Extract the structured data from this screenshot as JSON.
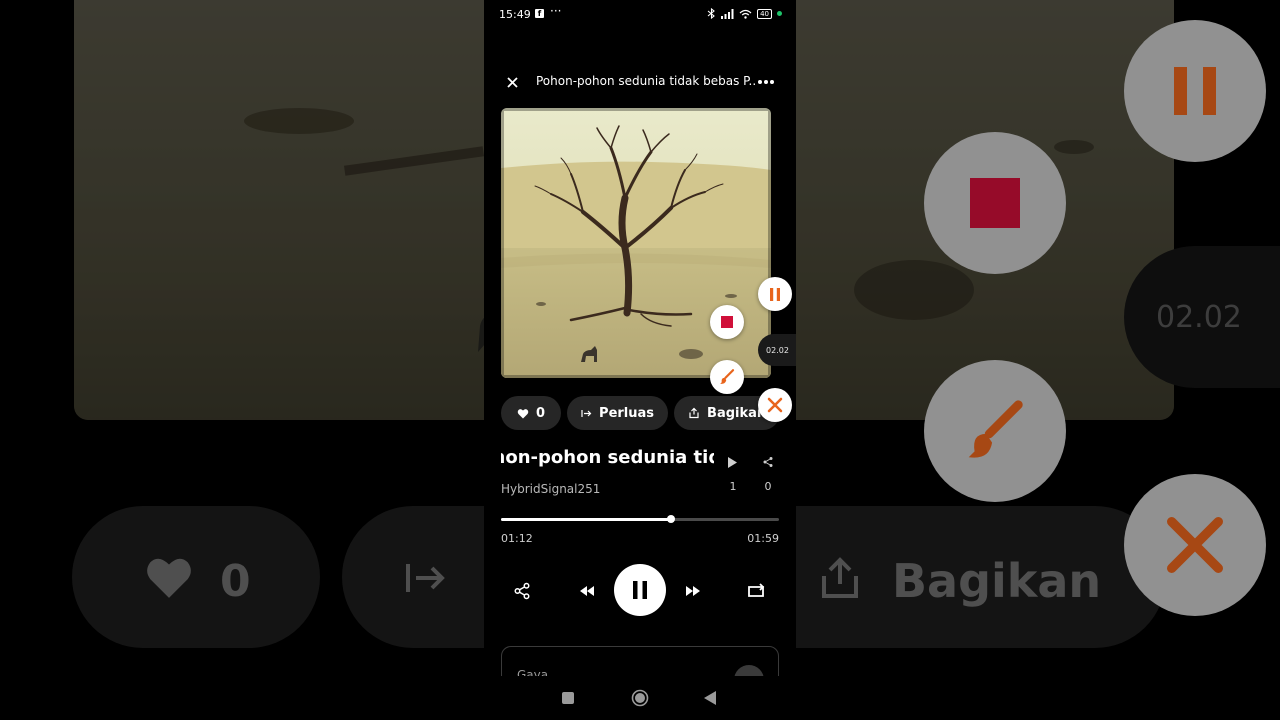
{
  "status_bar": {
    "time": "15:49",
    "notification_app": "f",
    "overflow": "···",
    "battery": "40"
  },
  "header": {
    "title": "Pohon-pohon sedunia tidak bebas P..."
  },
  "album_art": {
    "description_icon": "dead-tree-desert-artwork"
  },
  "floating_controls": {
    "timer": "02.02"
  },
  "actions": {
    "like_count": "0",
    "extend_label": "Perluas",
    "share_label": "Bagikan"
  },
  "song": {
    "title": "Pohon-pohon sedunia tidak bebas",
    "artist": "HybridSignal251",
    "plays": "1",
    "shares": "0"
  },
  "player": {
    "current_time": "01:12",
    "total_time": "01:59",
    "progress": 0.61
  },
  "style_card": {
    "label": "Gaya"
  },
  "background": {
    "like_count": "0",
    "share_label": "Bagikan",
    "timer": "02.02"
  },
  "colors": {
    "accent_orange": "#e8641c",
    "stop_red": "#d0103a",
    "chip_bg": "#262626"
  }
}
